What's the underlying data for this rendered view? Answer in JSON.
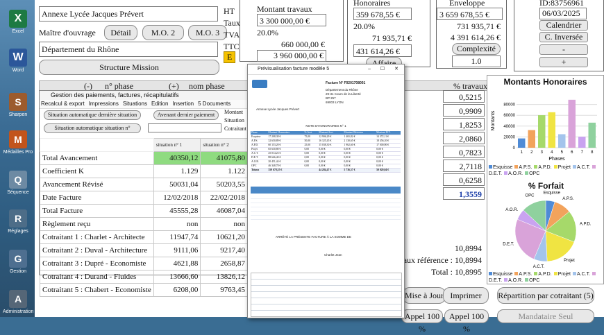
{
  "desktop": {
    "icons": [
      {
        "name": "excel",
        "label": "Excel",
        "color": "#1d7a43",
        "letter": "X"
      },
      {
        "name": "word",
        "label": "Word",
        "color": "#2b579a",
        "letter": "W"
      },
      {
        "name": "sharpen",
        "label": "Sharpen",
        "color": "#9c5b2d",
        "letter": "S"
      },
      {
        "name": "medal",
        "label": "Médailles Pro",
        "color": "#c2541c",
        "letter": "M"
      },
      {
        "name": "sequence",
        "label": "Séquence",
        "color": "#6d8aa3",
        "letter": "Q"
      },
      {
        "name": "settings",
        "label": "Réglages",
        "color": "#4d6d88",
        "letter": "R"
      },
      {
        "name": "manage",
        "label": "Gestion",
        "color": "#4e6f90",
        "letter": "G"
      },
      {
        "name": "admin",
        "label": "Administration",
        "color": "#556677",
        "letter": "A"
      }
    ]
  },
  "project": {
    "name": "Annexe Lycée Jacques Prévert",
    "owner_label": "Maître d'ouvrage",
    "owner": "Département du Rhône",
    "detail_btn": "Détail",
    "mo2_btn": "M.O. 2",
    "mo3_btn": "M.O. 3",
    "mission_btn": "Structure Mission",
    "labels": {
      "ht": "HT",
      "taux": "Taux",
      "tva": "TVA",
      "ttc": "TTC",
      "e": "E"
    }
  },
  "works": {
    "title": "Montant travaux",
    "amount": "3 300 000,00 €",
    "rate": "20.0%",
    "tva": "660 000,00 €",
    "ttc": "3 960 000,00 €"
  },
  "fees": {
    "title": "Honoraires",
    "ht": "359 678,55 €",
    "rate": "20.0%",
    "tva": "71 935,71 €",
    "ttc": "431 614,26 €",
    "affaire_btn": "Affaire"
  },
  "envelope": {
    "title": "Enveloppe",
    "ht": "3 659 678,55 €",
    "tva": "731 935,71 €",
    "ttc": "4 391 614,26 €",
    "complexity_btn": "Complexité",
    "complexity": "1.0"
  },
  "meta": {
    "id": "ID:83756961",
    "date": "06/03/2025",
    "calendar_btn": "Calendrier",
    "inverse_btn": "C. Inversée",
    "minus_btn": "-",
    "plus_btn": "+"
  },
  "phases": {
    "minus": "(-)",
    "num": "n° phase",
    "plus": "(+)",
    "name": "nom phase",
    "pct_header": "% travaux",
    "values": [
      "0,5215",
      "0,9909",
      "1,8253",
      "2,0860",
      "0,7823",
      "2,7118",
      "0,6258",
      "1,3559"
    ],
    "coef_values": [
      "10,8994",
      "Taux référence : 10,8994",
      "Total : 10,8995"
    ]
  },
  "subform": {
    "title": "Gestion des paiements, factures, récapitulatifs",
    "menu": [
      "Recalcul & export",
      "Impressions",
      "Situations",
      "Edition",
      "Insertion",
      "5 Documents"
    ],
    "btn_auto_last": "Situation automatique dernière situation",
    "btn_before_last": "Avenant dernier paiement",
    "btn_auto_n": "Situation automatique situation n°",
    "side_labels": [
      "Montant",
      "Situation",
      "Cotraitant"
    ],
    "columns": [
      "situation n° 1",
      "situation n° 2"
    ],
    "rows": [
      {
        "label": "Total Avancement",
        "v1": "40350,12",
        "v2": "41075,80",
        "hl": true
      },
      {
        "label": "Coefficient K",
        "v1": "1.129",
        "v2": "1.122"
      },
      {
        "label": "Avancement Révisé",
        "v1": "50031,04",
        "v2": "50203,55"
      },
      {
        "label": "Date Facture",
        "v1": "12/02/2018",
        "v2": "22/02/2018"
      },
      {
        "label": "Total Facture",
        "v1": "45555,28",
        "v2": "46087,04"
      },
      {
        "label": "Règlement reçu",
        "v1": "non",
        "v2": "non"
      },
      {
        "label": "Cotraitant 1 : Charlet - Architecte",
        "v1": "11947,74",
        "v2": "10621,20"
      },
      {
        "label": "Cotraitant 2 : Duval - Architecture",
        "v1": "9111,06",
        "v2": "9217,40"
      },
      {
        "label": "Cotraitant 3 : Dupré - Economiste",
        "v1": "4621,88",
        "v2": "2658,87"
      },
      {
        "label": "Cotraitant 4 : Durand - Fluides",
        "v1": "13666,60",
        "v2": "13826,12"
      },
      {
        "label": "Cotraitant 5 : Chabert - Economiste",
        "v1": "6208,00",
        "v2": "9763,45"
      }
    ]
  },
  "preview": {
    "title": "Prévisualisation facture modèle 5",
    "invoice_no": "Facture N° F0201708001",
    "addressee": [
      "Département du Rhône",
      "29-31 Cours de la Liberté",
      "BP 257",
      "69003 LYON"
    ],
    "object": "Annexe Lycée Jacques Prévert",
    "note": "NOTE D'HONORAIRES N° 1",
    "table_headers": [
      "Phase",
      "Montant Honoraires",
      "% Avct",
      "Montant Avct",
      "Montant Révision",
      "Montant H.T."
    ],
    "table_rows": [
      [
        "Esquisse",
        "17 208,38 €",
        "75,00",
        "12 906,29 €",
        "1 465,82 €",
        "14 372,11 €"
      ],
      [
        "A.P.S.",
        "32 650,89 €",
        "50,00",
        "16 325,45 €",
        "2 130,65 €",
        "18 456,10 €"
      ],
      [
        "A.P.D.",
        "60 153,20 €",
        "25,00",
        "15 038,30 €",
        "1 962,60 €",
        "17 000,90 €"
      ],
      [
        "Projet",
        "65 630,80 €",
        "0,00",
        "0,00 €",
        "0,00 €",
        "0,00 €"
      ],
      [
        "A.C.T.",
        "25 014,23 €",
        "0,00",
        "0,00 €",
        "0,00 €",
        "0,00 €"
      ],
      [
        "D.E.T.",
        "88 666,40 €",
        "0,00",
        "0,00 €",
        "0,00 €",
        "0,00 €"
      ],
      [
        "A.O.R.",
        "20 451,44 €",
        "0,00",
        "0,00 €",
        "0,00 €",
        "0,00 €"
      ],
      [
        "OPC",
        "46 348,78 €",
        "0,00",
        "0,00 €",
        "0,00 €",
        "0,00 €"
      ]
    ],
    "total_row": [
      "Totaux",
      "359 678,55 €",
      "",
      "44 284,47 €",
      "5 736,57 €",
      "50 020,04 €"
    ],
    "footer": "ARRÊTÉ LA PRÉSENTE FACTURE À LA SOMME DE",
    "sign": "Charlet Jean"
  },
  "chart_honoraires": {
    "title": "Montants Honoraires",
    "ylabel": "Montants",
    "xlabel": "Phases"
  },
  "chart_data": [
    {
      "type": "bar",
      "title": "Montants Honoraires",
      "xlabel": "Phases",
      "ylabel": "Montants",
      "categories": [
        "1",
        "2",
        "3",
        "4",
        "5",
        "6",
        "7",
        "8"
      ],
      "values": [
        17208,
        32651,
        60153,
        65631,
        25014,
        88666,
        20451,
        46349
      ],
      "colors": [
        "#4f8bd6",
        "#f2a35c",
        "#a6d96a",
        "#f0e442",
        "#a3c4ec",
        "#d9a3d9",
        "#c9a3f0",
        "#8fd19e"
      ],
      "ylim": [
        0,
        100000
      ],
      "yticks": [
        0,
        20000,
        40000,
        60000,
        80000
      ],
      "legend": [
        "Esquisse",
        "A.P.S.",
        "A.P.D.",
        "Projet",
        "A.C.T.",
        "D.E.T.",
        "A.O.R.",
        "OPC"
      ]
    },
    {
      "type": "pie",
      "title": "% Forfait",
      "labels": [
        "Esquisse",
        "A.P.S.",
        "A.P.D.",
        "Projet",
        "A.C.T.",
        "D.E.T.",
        "A.O.R.",
        "OPC"
      ],
      "values": [
        4.8,
        9.1,
        16.7,
        18.2,
        7.0,
        24.7,
        5.7,
        12.9
      ],
      "colors": [
        "#4f8bd6",
        "#f2a35c",
        "#a6d96a",
        "#f0e442",
        "#a3c4ec",
        "#d9a3d9",
        "#c9a3f0",
        "#8fd19e"
      ]
    }
  ],
  "footer_btns": {
    "mise_a_jour": "Mise à Jour",
    "imprimer": "Imprimer",
    "repartition": "Répartition par cotraitant (5)",
    "appel1": "Appel 100 %",
    "appel2": "Appel 100 %",
    "mandataire": "Mandataire Seul"
  }
}
